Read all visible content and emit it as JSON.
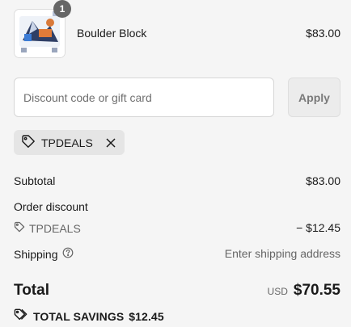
{
  "product": {
    "name": "Boulder Block",
    "price": "$83.00",
    "quantity": "1",
    "thumbnail_icon": "product-thumbnail-image"
  },
  "discount": {
    "placeholder": "Discount code or gift card",
    "value": "",
    "apply_label": "Apply"
  },
  "applied_code": {
    "code": "TPDEALS",
    "tag_icon": "tag-icon",
    "remove_icon": "close-icon"
  },
  "summary": {
    "subtotal_label": "Subtotal",
    "subtotal_value": "$83.00",
    "order_discount_label": "Order discount",
    "discount_code": "TPDEALS",
    "discount_value": "− $12.45",
    "shipping_label": "Shipping",
    "shipping_help_icon": "help-circle-icon",
    "shipping_value": "Enter shipping address"
  },
  "total": {
    "label": "Total",
    "currency": "USD",
    "amount": "$70.55"
  },
  "savings": {
    "label": "TOTAL SAVINGS",
    "amount": "$12.45",
    "icon": "tags-icon"
  },
  "colors": {
    "background": "#f5f5f5",
    "badge": "#666666",
    "apply_button_bg": "#ececec",
    "tag_bg": "#e5e5e5",
    "muted_text": "#666666"
  }
}
